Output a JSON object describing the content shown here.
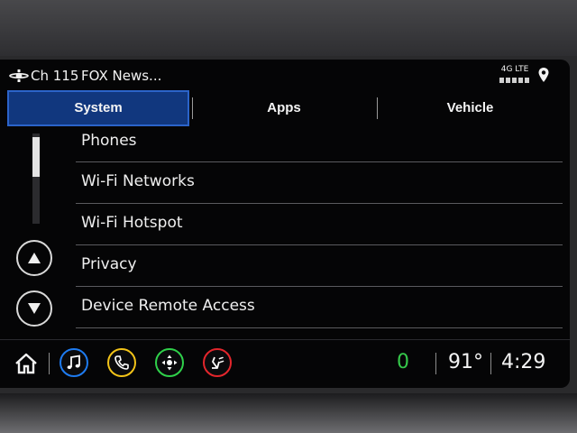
{
  "status": {
    "channel": "Ch 115",
    "station": "FOX News...",
    "network": "4G LTE",
    "signal_bars": 5,
    "icons": [
      "sirius-satellite-icon",
      "location-pin-icon"
    ]
  },
  "tabs": [
    {
      "label": "System",
      "active": true
    },
    {
      "label": "Apps",
      "active": false
    },
    {
      "label": "Vehicle",
      "active": false
    }
  ],
  "settings_list": {
    "items": [
      "Phones",
      "Wi-Fi Networks",
      "Wi-Fi Hotspot",
      "Privacy",
      "Device Remote Access"
    ]
  },
  "bottom_bar": {
    "icons": [
      "home-icon",
      "music-note-icon",
      "phone-icon",
      "navigation-icon",
      "seat-climate-icon"
    ],
    "icon_colors": {
      "music": "#1e7bf0",
      "phone": "#f2c318",
      "navigation": "#2fd04a",
      "climate": "#e3262c"
    },
    "counter": "0",
    "temperature": "91°",
    "time": "4:29"
  },
  "colors": {
    "active_tab": "#11377e",
    "active_tab_border": "#2b63c9",
    "counter": "#35c74a"
  }
}
